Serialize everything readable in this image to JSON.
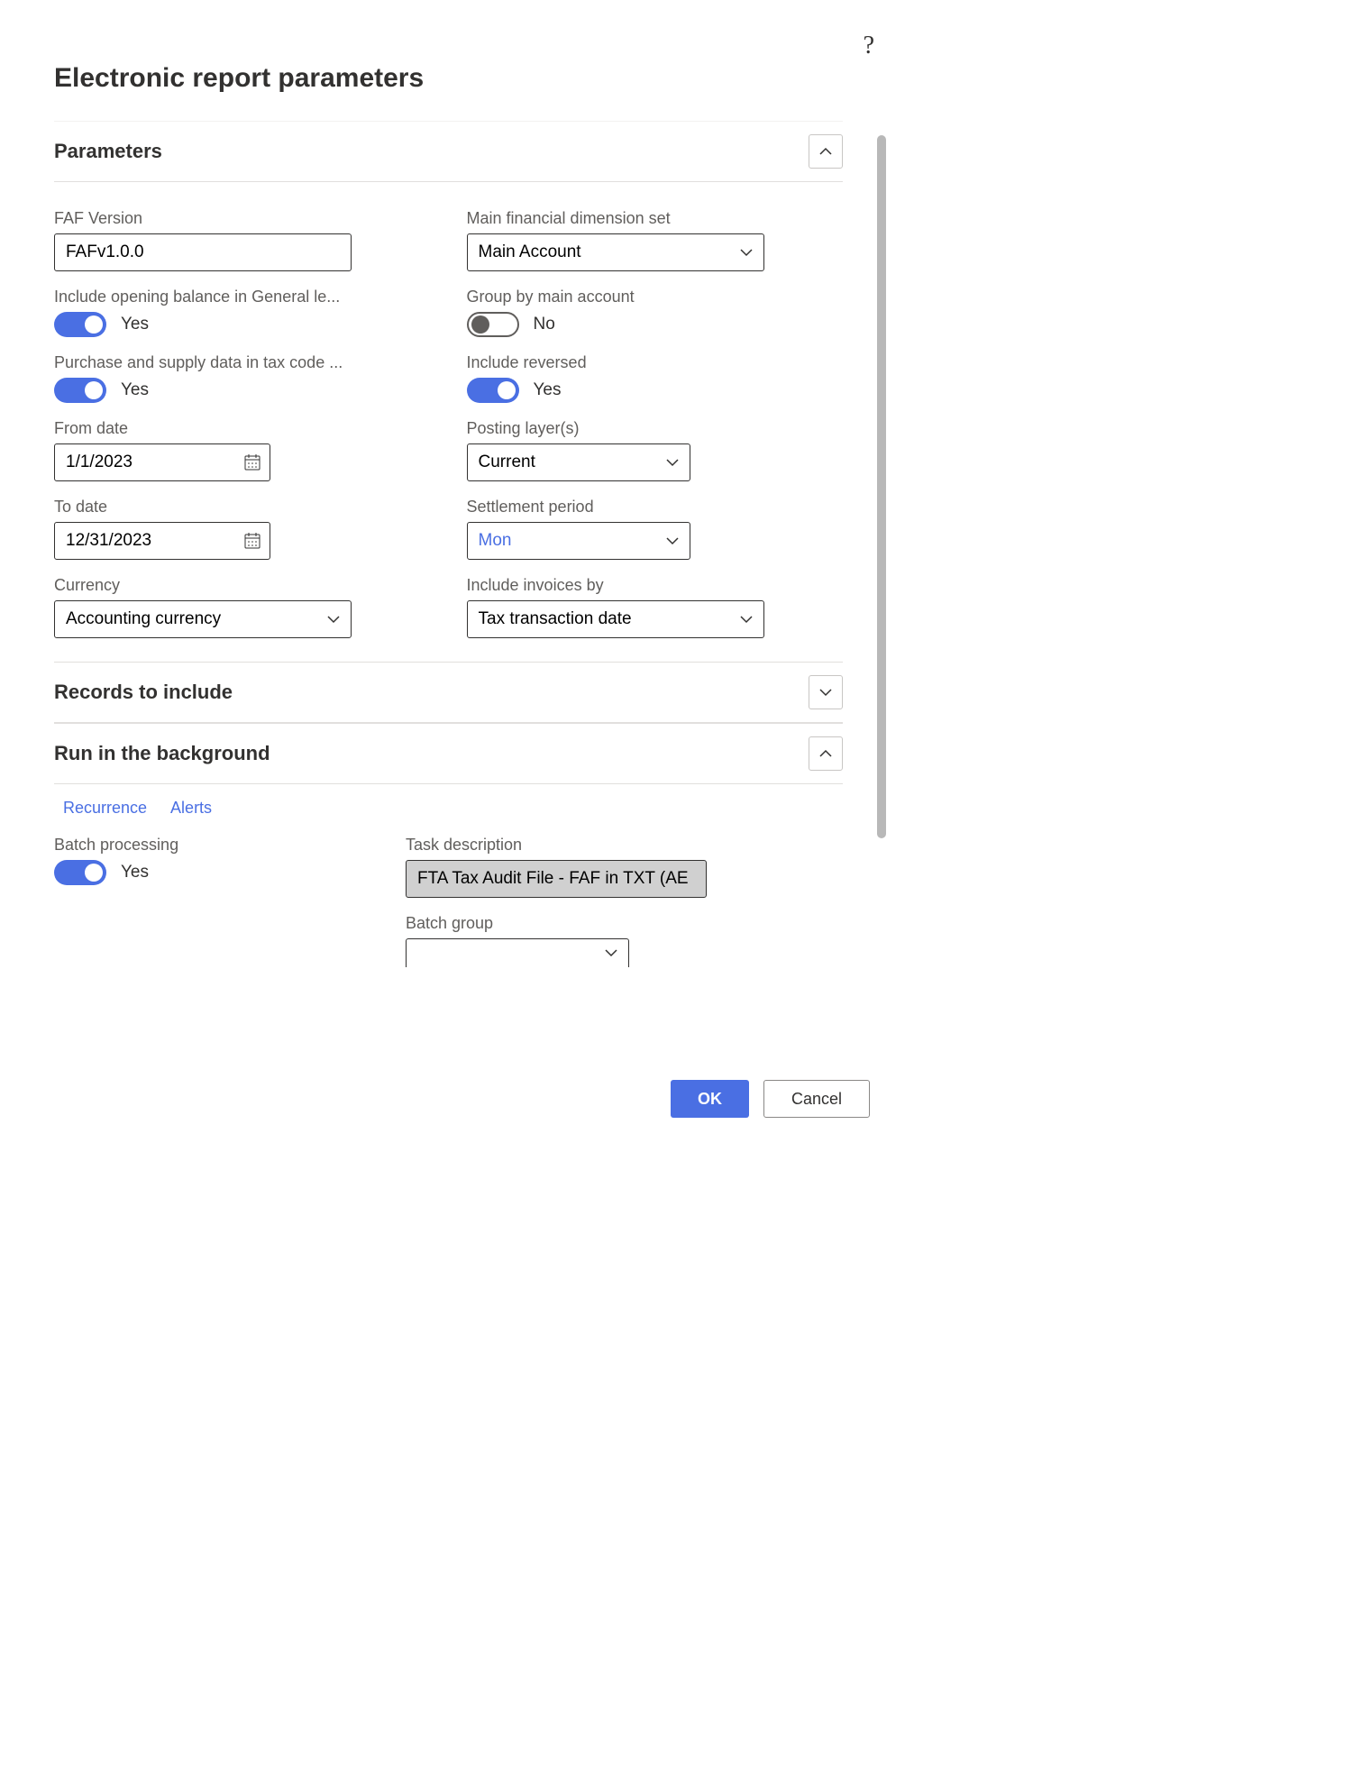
{
  "dialog": {
    "title": "Electronic report parameters"
  },
  "sections": {
    "parameters": {
      "title": "Parameters"
    },
    "records": {
      "title": "Records to include"
    },
    "background": {
      "title": "Run in the background"
    }
  },
  "parameters": {
    "faf_version": {
      "label": "FAF Version",
      "value": "FAFv1.0.0"
    },
    "include_opening": {
      "label": "Include opening balance in General le...",
      "value": "Yes",
      "on": true
    },
    "purchase_supply": {
      "label": "Purchase and supply data in tax code ...",
      "value": "Yes",
      "on": true
    },
    "from_date": {
      "label": "From date",
      "value": "1/1/2023"
    },
    "to_date": {
      "label": "To date",
      "value": "12/31/2023"
    },
    "currency": {
      "label": "Currency",
      "value": "Accounting currency"
    },
    "main_dim_set": {
      "label": "Main financial dimension set",
      "value": "Main Account"
    },
    "group_main": {
      "label": "Group by main account",
      "value": "No",
      "on": false
    },
    "include_reversed": {
      "label": "Include reversed",
      "value": "Yes",
      "on": true
    },
    "posting_layer": {
      "label": "Posting layer(s)",
      "value": "Current"
    },
    "settlement_period": {
      "label": "Settlement period",
      "value": "Mon"
    },
    "include_invoices": {
      "label": "Include invoices by",
      "value": "Tax transaction date"
    }
  },
  "background": {
    "tabs": {
      "recurrence": "Recurrence",
      "alerts": "Alerts"
    },
    "batch_processing": {
      "label": "Batch processing",
      "value": "Yes",
      "on": true
    },
    "task_description": {
      "label": "Task description",
      "value": "FTA Tax Audit File - FAF in TXT (AE"
    },
    "batch_group": {
      "label": "Batch group",
      "value": ""
    }
  },
  "footer": {
    "ok": "OK",
    "cancel": "Cancel"
  }
}
